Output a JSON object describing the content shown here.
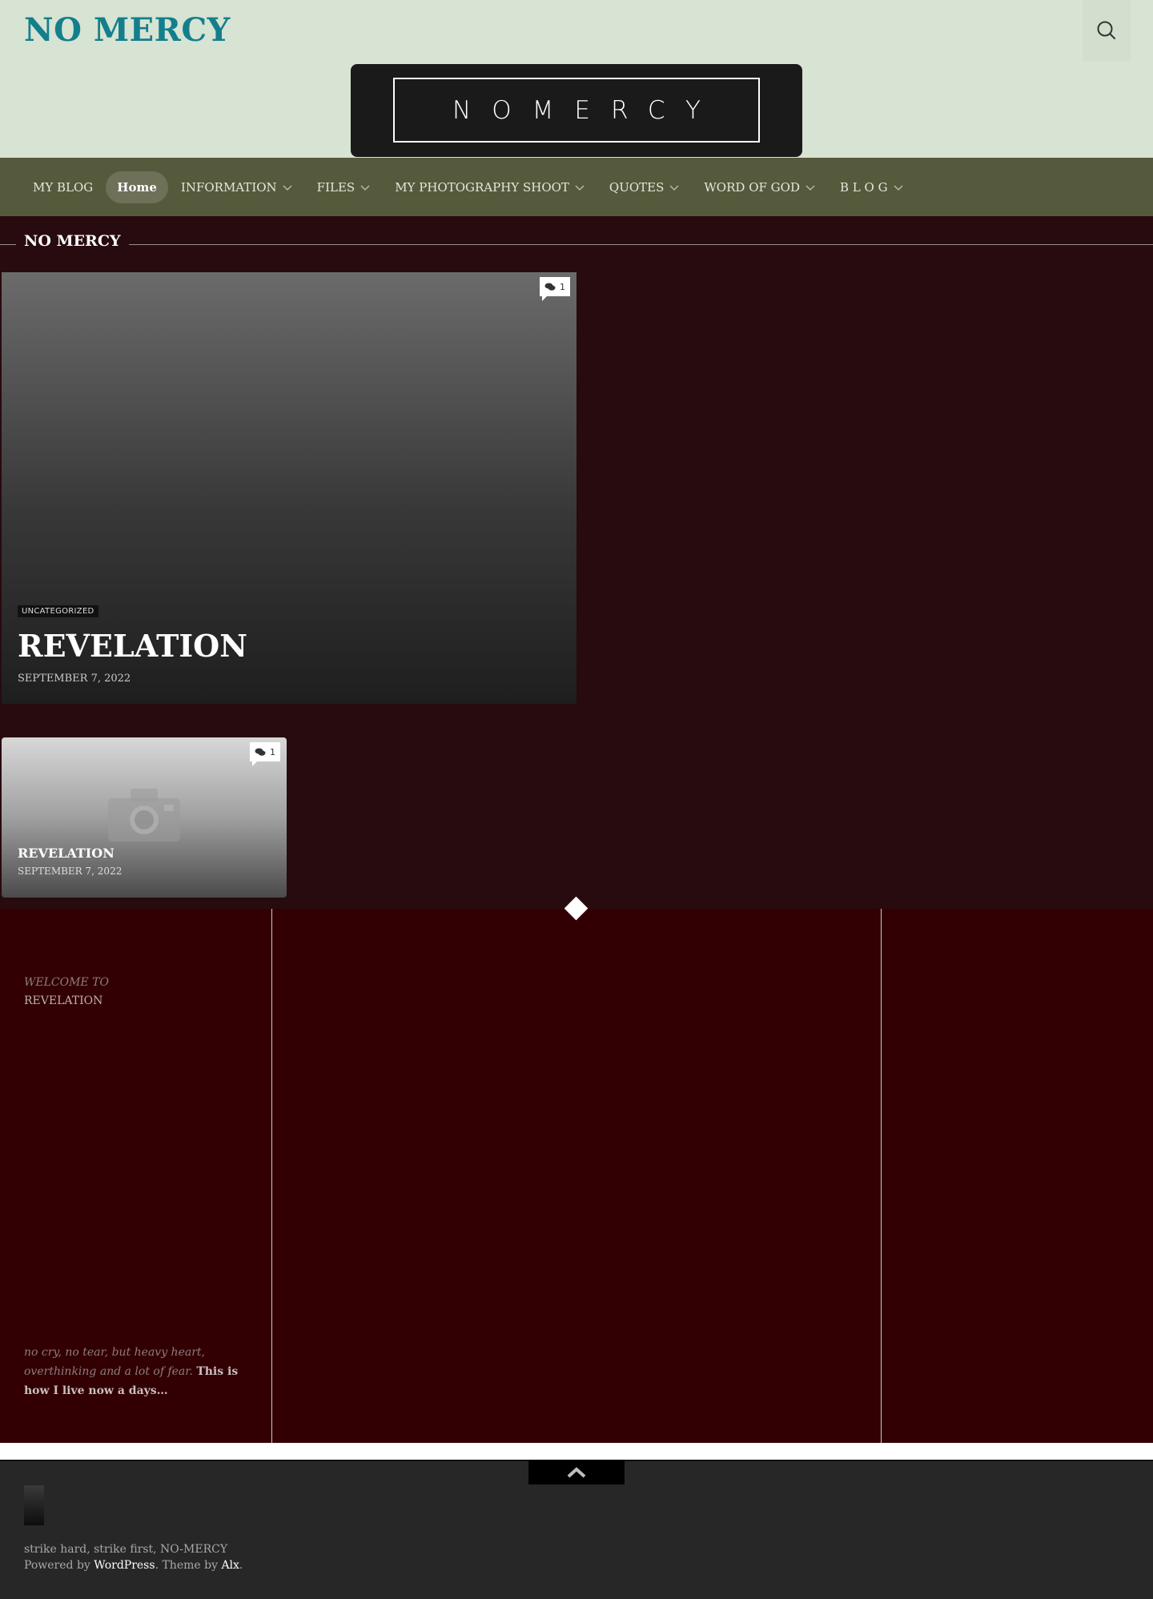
{
  "header": {
    "site_title": "NO MERCY",
    "logo_text": "NOMERCY"
  },
  "nav": {
    "items": [
      {
        "label": "MY BLOG",
        "dropdown": false,
        "active": false
      },
      {
        "label": "Home",
        "dropdown": false,
        "active": true
      },
      {
        "label": "INFORMATION",
        "dropdown": true,
        "active": false
      },
      {
        "label": "FILES",
        "dropdown": true,
        "active": false
      },
      {
        "label": "MY PHOTOGRAPHY SHOOT",
        "dropdown": true,
        "active": false
      },
      {
        "label": "QUOTES",
        "dropdown": true,
        "active": false
      },
      {
        "label": "WORD OF GOD",
        "dropdown": true,
        "active": false
      },
      {
        "label": "B L O G",
        "dropdown": true,
        "active": false
      }
    ]
  },
  "section": {
    "title": "NO MERCY"
  },
  "featured": {
    "comment_count": "1",
    "category": "UNCATEGORIZED",
    "title": "REVELATION",
    "date": "SEPTEMBER 7, 2022"
  },
  "small_post": {
    "comment_count": "1",
    "title": "REVELATION",
    "date": "SEPTEMBER 7, 2022"
  },
  "widgets": {
    "welcome_line1": "WELCOME TO",
    "welcome_line2": "REVELATION",
    "quote_italic": "no cry, no tear, but heavy heart, overthinking and a lot of fear.",
    "quote_bold": "This is how I live now a days…"
  },
  "footer": {
    "tagline": "strike hard, strike first, NO-MERCY",
    "powered_prefix": "Powered by ",
    "powered_link": "WordPress",
    "theme_prefix": ". Theme by ",
    "theme_link": "Alx",
    "theme_suffix": "."
  },
  "colors": {
    "header_bg": "#d7e3d3",
    "site_title": "#147f8c",
    "nav_bg": "#565a3c",
    "page_bg": "#270b0e",
    "widgets_bg": "#320003",
    "footer_bg": "#272727"
  }
}
